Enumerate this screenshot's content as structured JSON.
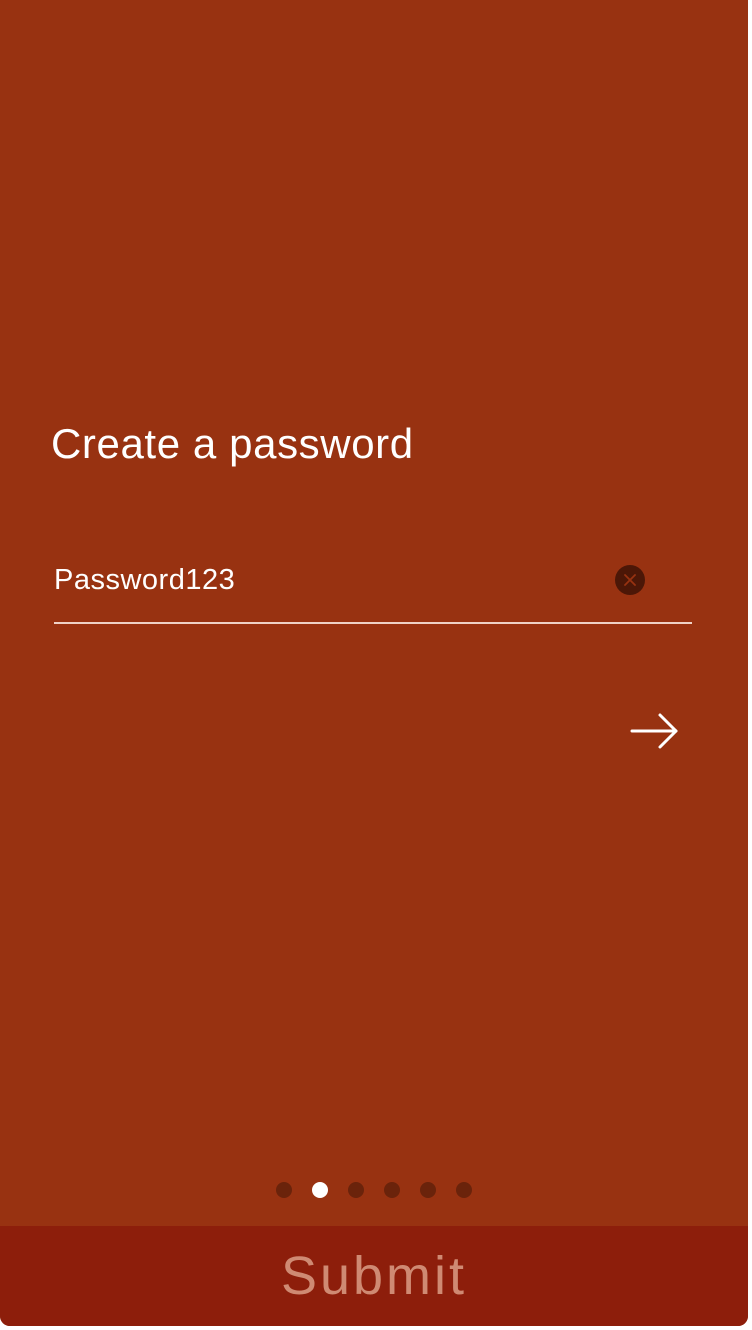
{
  "form": {
    "title": "Create a password",
    "password_value": "Password123",
    "clear_icon": "close-icon",
    "next_icon": "arrow-right-icon"
  },
  "pagination": {
    "total_steps": 6,
    "current_step": 2
  },
  "footer": {
    "submit_label": "Submit"
  },
  "colors": {
    "background": "#983211",
    "submit_bar": "#8d1e0b",
    "submit_text": "#cf8a73",
    "dot_inactive": "#6a230b",
    "dot_active": "#ffffff",
    "clear_button": "#4c1707"
  }
}
